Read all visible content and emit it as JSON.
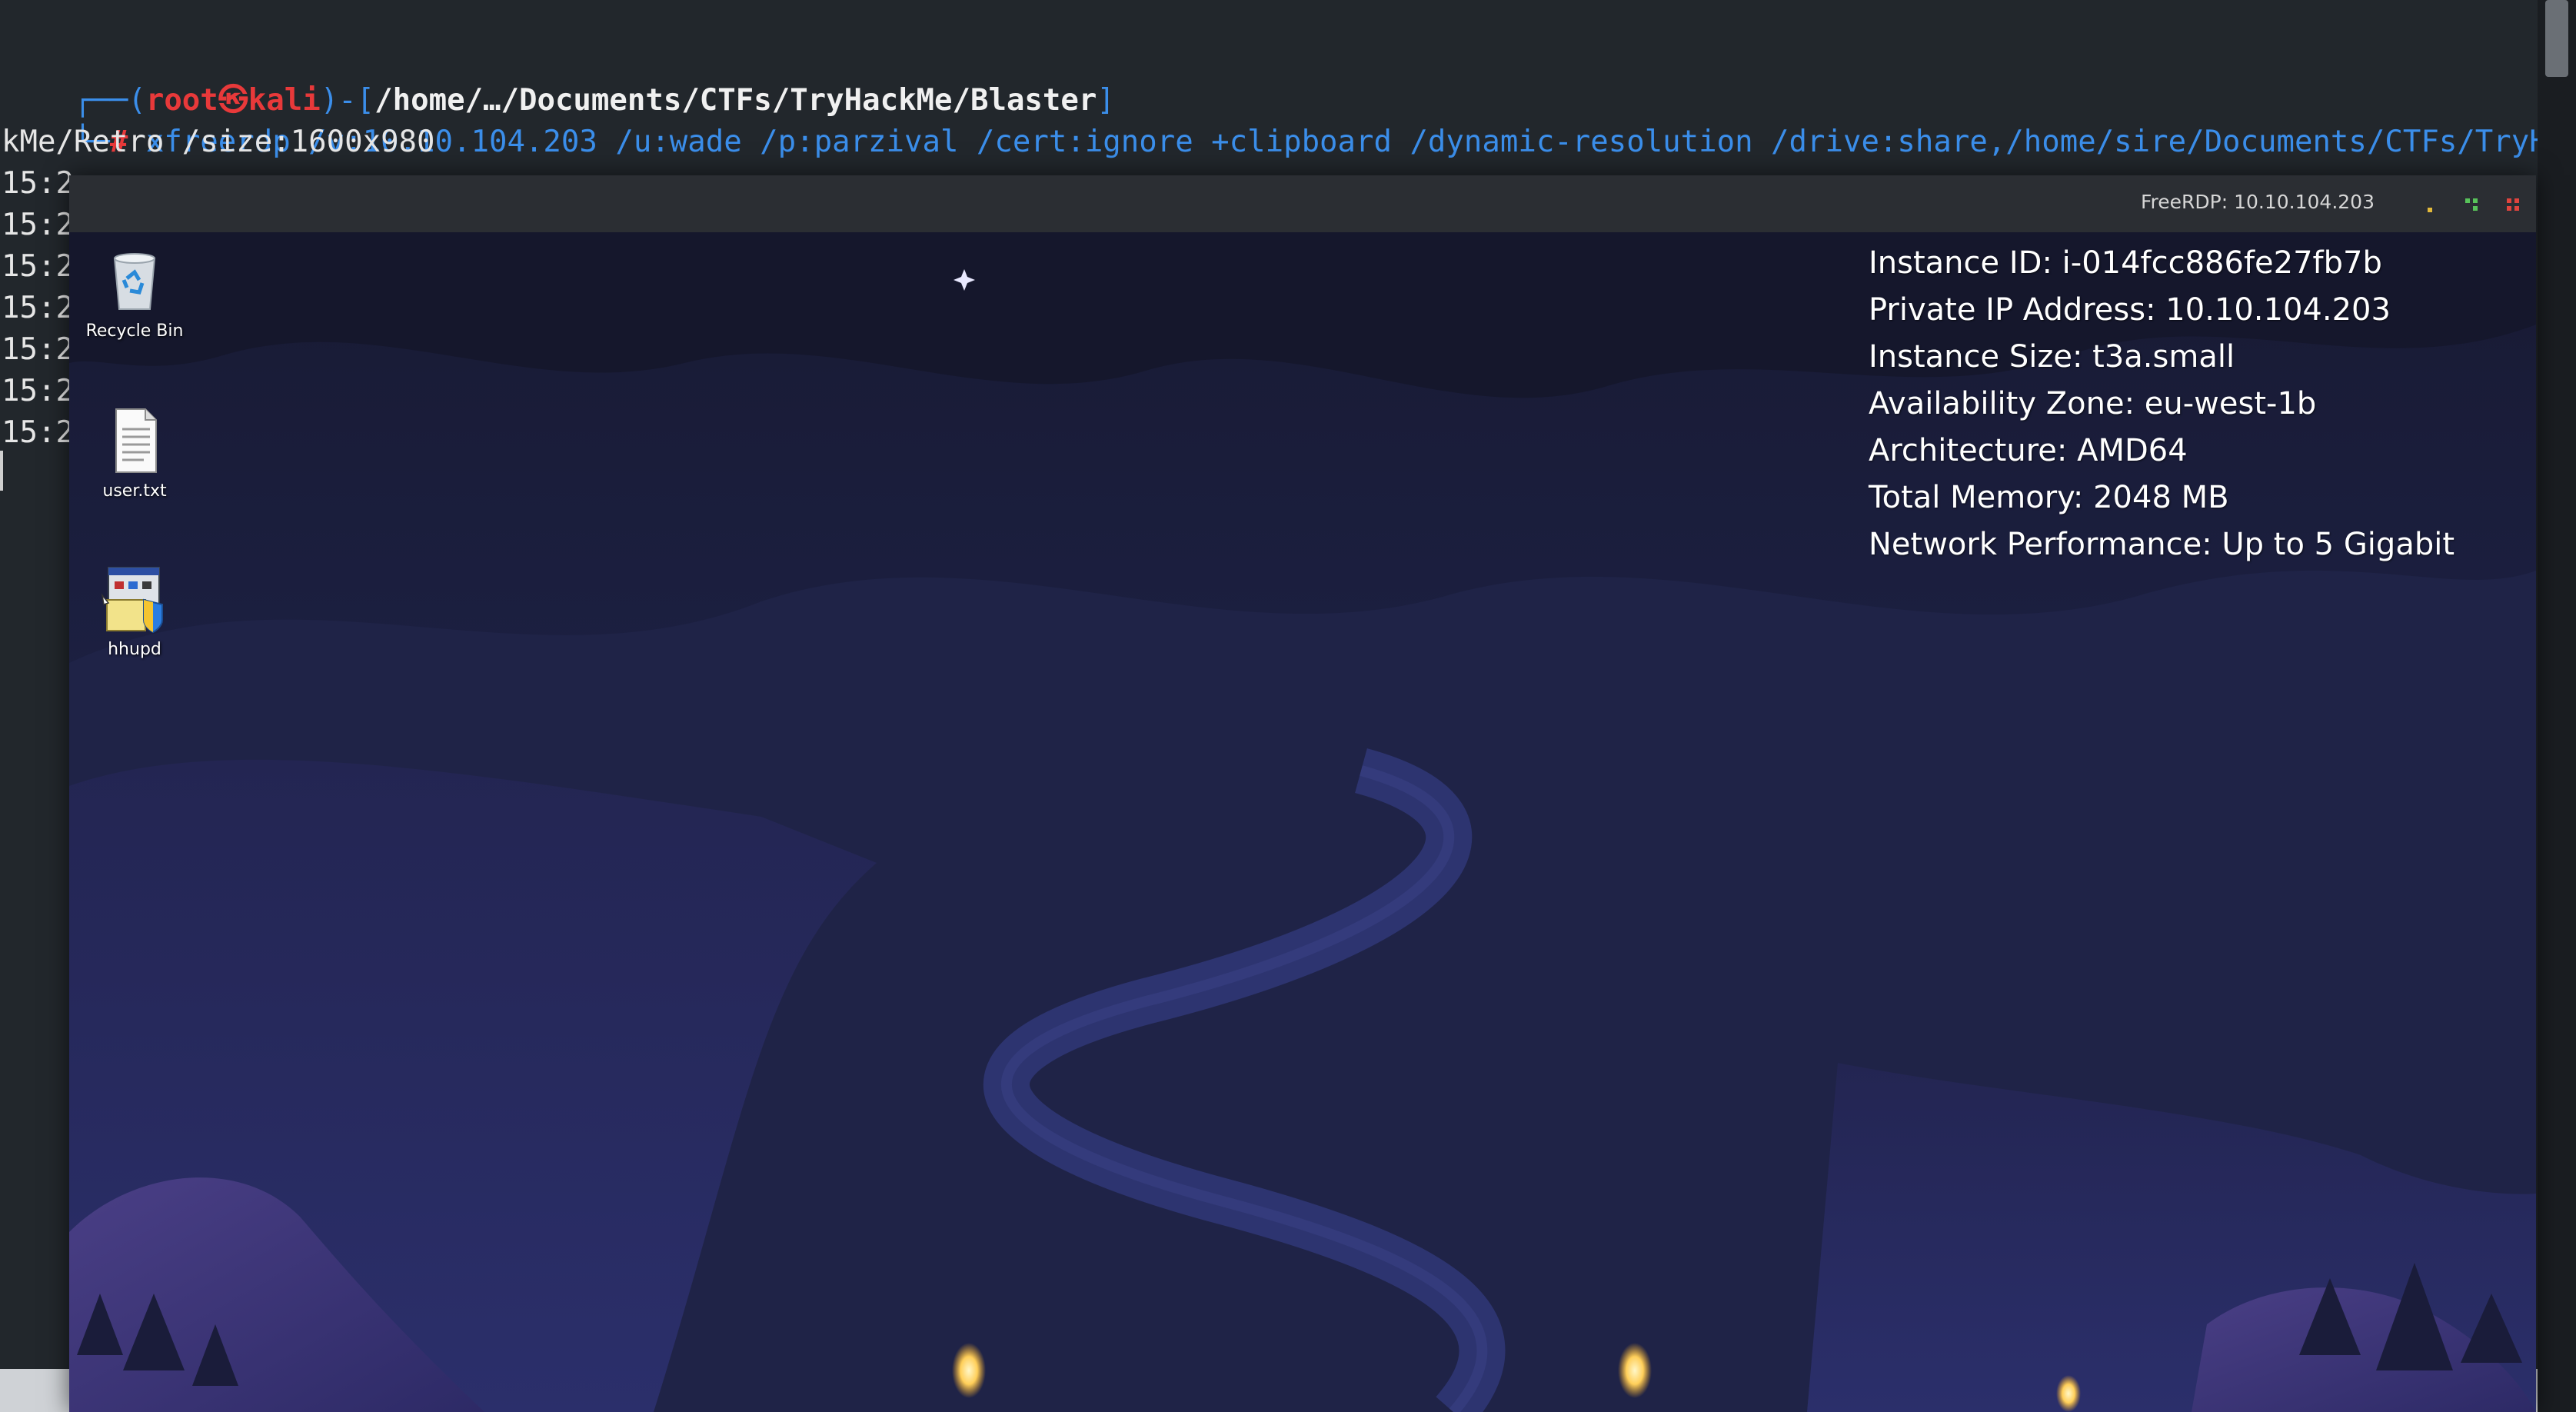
{
  "terminal": {
    "prompt": {
      "corner": "┌──(",
      "user": "root",
      "at_symbol": "㉿",
      "host": "kali",
      "sep": ")-[",
      "path": "/home/…/Documents/CTFs/TryHackMe/Blaster",
      "close": "]",
      "hash_prefix": "└─",
      "hash": "#"
    },
    "command_line_1": " xfreerdp /v:10.10.104.203 /u:wade /p:parzival /cert:ignore +clipboard /dynamic-resolution /drive:share,/home/sire/Documents/CTFs/TryHa",
    "command_line_2": "kMe/Retro /size:1600x980",
    "log_partial": "15:2",
    "colors": {
      "background": "#22272c",
      "prompt_blue": "#3b8eea",
      "prompt_red": "#e8393a"
    }
  },
  "rdp_window": {
    "title": "FreeRDP: 10.10.104.203",
    "controls": [
      "minimize-icon",
      "maximize-icon",
      "close-icon"
    ],
    "control_colors": {
      "minimize": "#e2b93b",
      "maximize": "#58c35a",
      "close": "#e0443e"
    }
  },
  "desktop": {
    "icons": [
      {
        "label": "Recycle Bin",
        "icon": "recycle-bin-icon"
      },
      {
        "label": "user.txt",
        "icon": "text-file-icon"
      },
      {
        "label": "hhupd",
        "icon": "installer-app-icon"
      }
    ],
    "instance_info": {
      "instance_id": "Instance ID: i-014fcc886fe27fb7b",
      "private_ip": "Private IP Address: 10.10.104.203",
      "instance_size": "Instance Size: t3a.small",
      "availability_zone": "Availability Zone: eu-west-1b",
      "architecture": "Architecture: AMD64",
      "total_memory": "Total Memory: 2048 MB",
      "network_performance": "Network Performance: Up to 5 Gigabit"
    }
  }
}
